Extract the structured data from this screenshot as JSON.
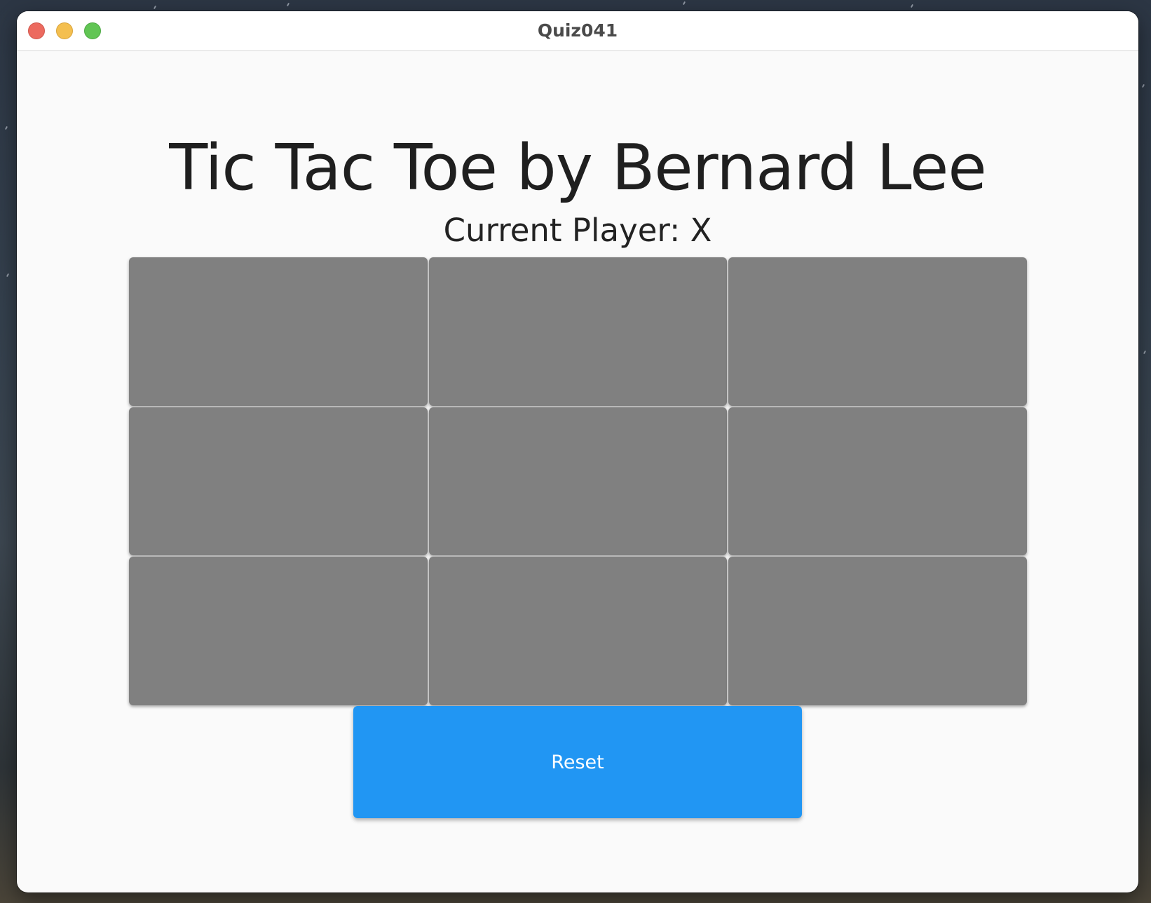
{
  "window": {
    "title": "Quiz041"
  },
  "app": {
    "heading": "Tic Tac Toe by Bernard Lee",
    "current_player": "Current Player: X",
    "board": [
      "",
      "",
      "",
      "",
      "",
      "",
      "",
      "",
      ""
    ],
    "reset_label": "Reset"
  },
  "colors": {
    "cell": "#808080",
    "reset_button": "#2196f3",
    "window_background": "#fafafa"
  },
  "icons": [
    "close-icon",
    "minimize-icon",
    "maximize-icon"
  ]
}
